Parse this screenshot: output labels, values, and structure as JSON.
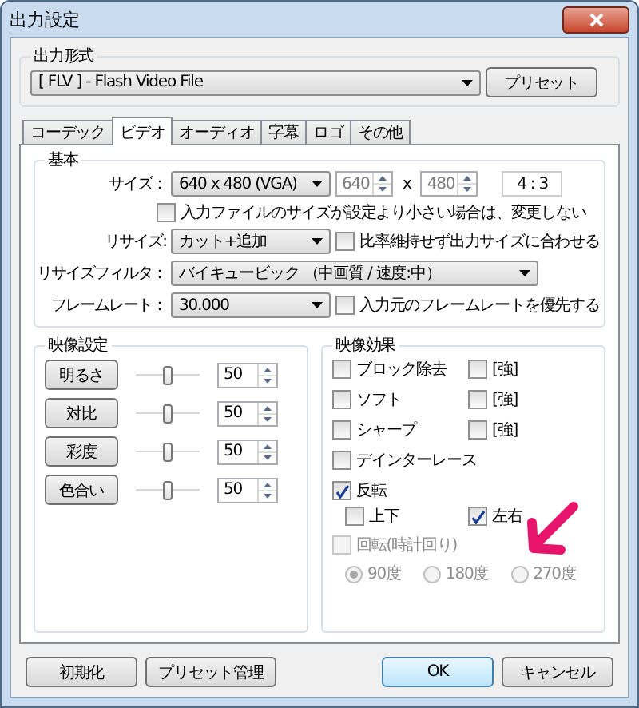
{
  "window": {
    "title": "出力設定"
  },
  "output_format": {
    "title": "出力形式",
    "value": "[ FLV ] - Flash Video File",
    "preset_button": "プリセット"
  },
  "tabs": [
    {
      "label": "コーデック",
      "selected": false
    },
    {
      "label": "ビデオ",
      "selected": true
    },
    {
      "label": "オーディオ",
      "selected": false
    },
    {
      "label": "字幕",
      "selected": false
    },
    {
      "label": "ロゴ",
      "selected": false
    },
    {
      "label": "その他",
      "selected": false
    }
  ],
  "basic": {
    "title": "基本",
    "size": {
      "label": "サイズ：",
      "value": "640 x 480 (VGA)",
      "width": {
        "value": "640",
        "disabled": true
      },
      "separator": "x",
      "height": {
        "value": "480",
        "disabled": true
      },
      "ratio": "4 : 3"
    },
    "keep_small": {
      "label": "入力ファイルのサイズが設定より小さい場合は、変更しない",
      "checked": false
    },
    "resize": {
      "label": "リサイズ:",
      "value": "カット+追加"
    },
    "fit_ratio": {
      "label": "比率維持せず出力サイズに合わせる",
      "checked": false
    },
    "filter": {
      "label": "リサイズフィルタ：",
      "value": "バイキュービック （中画質 / 速度:中）"
    },
    "framerate": {
      "label": "フレームレート：",
      "value": "30.000"
    },
    "prefer_input_rate": {
      "label": "入力元のフレームレートを優先する",
      "checked": false
    }
  },
  "image_settings": {
    "title": "映像設定",
    "rows": [
      {
        "label": "明るさ",
        "level": 0.5,
        "value": "50"
      },
      {
        "label": "対比",
        "level": 0.5,
        "value": "50"
      },
      {
        "label": "彩度",
        "level": 0.5,
        "value": "50"
      },
      {
        "label": "色合い",
        "level": 0.5,
        "value": "50"
      }
    ]
  },
  "effects": {
    "title": "映像効果",
    "filters": [
      {
        "label": "ブロック除去",
        "checked": false,
        "strong": {
          "label": "[強]",
          "checked": false
        }
      },
      {
        "label": "ソフト",
        "checked": false,
        "strong": {
          "label": "[強]",
          "checked": false
        }
      },
      {
        "label": "シャープ",
        "checked": false,
        "strong": {
          "label": "[強]",
          "checked": false
        }
      }
    ],
    "deinterlace": {
      "label": "デインターレース",
      "checked": false
    },
    "flip": {
      "label": "反転",
      "checked": true,
      "vertical": {
        "label": "上下",
        "checked": false
      },
      "horizontal": {
        "label": "左右",
        "checked": true
      }
    },
    "rotate": {
      "label": "回転(時計回り)",
      "checked": false,
      "disabled": true,
      "options": [
        {
          "label": "90度",
          "selected": true
        },
        {
          "label": "180度",
          "selected": false
        },
        {
          "label": "270度",
          "selected": false
        }
      ]
    }
  },
  "buttons_left": [
    "初期化",
    "プリセット管理"
  ],
  "buttons_right": [
    {
      "label": "OK",
      "default": true
    },
    {
      "label": "キャンセル",
      "default": false
    }
  ]
}
